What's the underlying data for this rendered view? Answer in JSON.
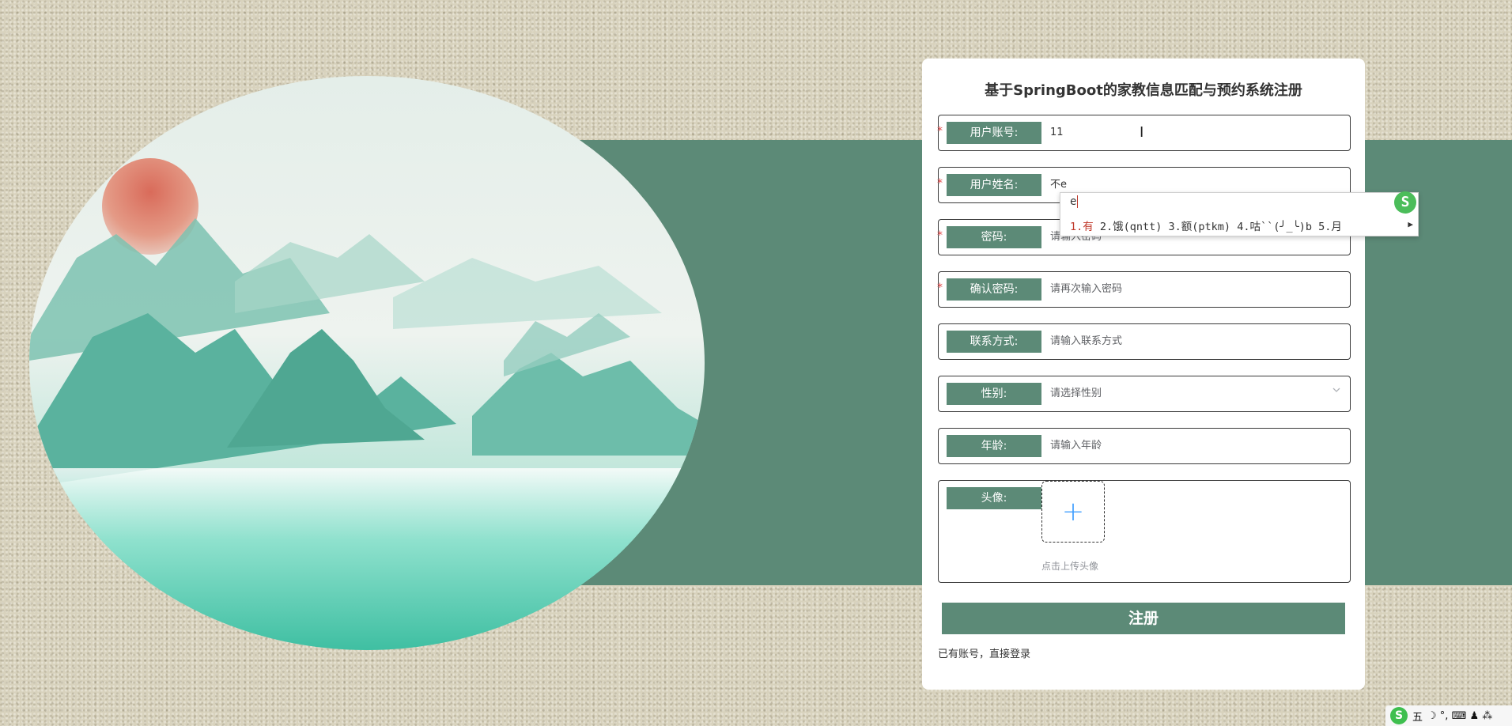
{
  "page": {
    "title": "基于SpringBoot的家教信息匹配与预约系统注册"
  },
  "form": {
    "fields": [
      {
        "label": "用户账号:",
        "value": "11",
        "placeholder": "",
        "required": true
      },
      {
        "label": "用户姓名:",
        "value": "不e",
        "placeholder": "",
        "required": true
      },
      {
        "label": "密码:",
        "value": "",
        "placeholder": "请输入密码",
        "required": true
      },
      {
        "label": "确认密码:",
        "value": "",
        "placeholder": "请再次输入密码",
        "required": true
      },
      {
        "label": "联系方式:",
        "value": "",
        "placeholder": "请输入联系方式",
        "required": false
      },
      {
        "label": "性别:",
        "value": "",
        "placeholder": "请选择性别",
        "required": false
      },
      {
        "label": "年龄:",
        "value": "",
        "placeholder": "请输入年龄",
        "required": false
      }
    ],
    "avatar": {
      "label": "头像:",
      "hint": "点击上传头像",
      "icon": "plus-icon"
    },
    "submit_label": "注册",
    "login_link": "已有账号，直接登录",
    "required_mark": "*"
  },
  "ime": {
    "composition": "e",
    "candidates": "1.有  2.饿(qntt)  3.额(ptkm)  4.咕``(╯_╰)b  5.月",
    "first_candidate": "1.有",
    "rest_candidates": "  2.饿(qntt)  3.额(ptkm)  4.咕``(╯_╰)b  5.月",
    "logo": "S"
  },
  "taskbar": {
    "logo": "S",
    "mode": "五",
    "icons": "☽ °, ⌨ ♟ ⁂"
  },
  "colors": {
    "accent": "#5c8a77",
    "required": "#e04646",
    "upload_plus": "#409eff"
  }
}
